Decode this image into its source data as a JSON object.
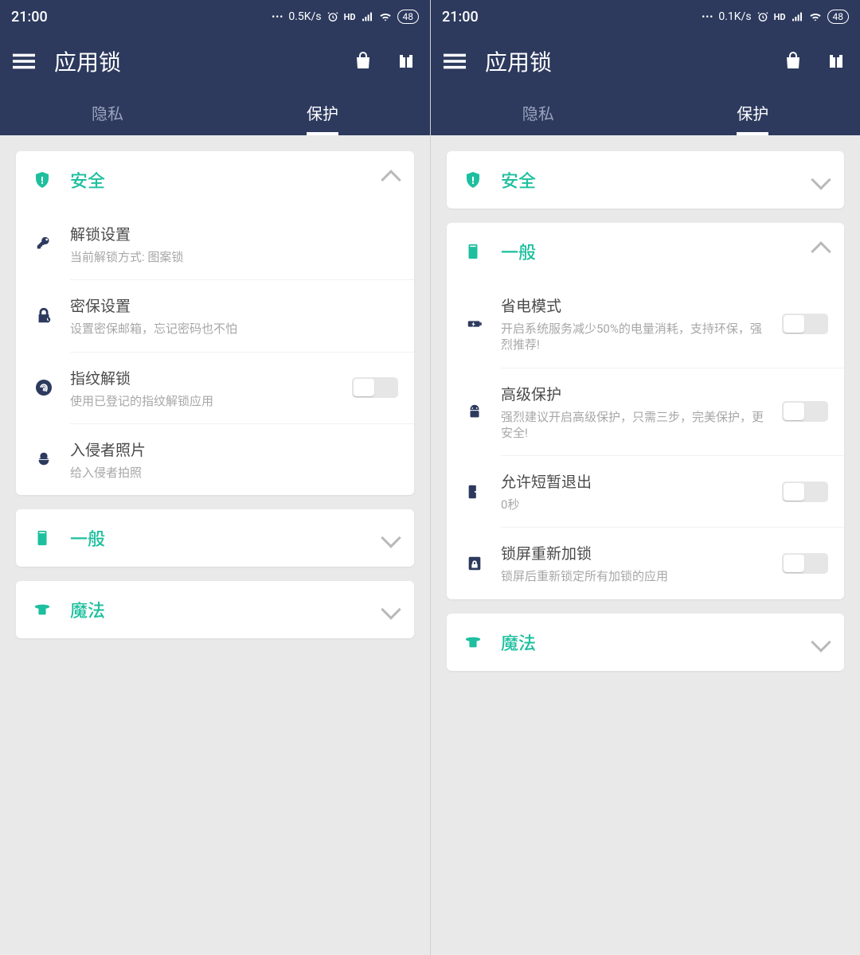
{
  "left": {
    "status": {
      "time": "21:00",
      "speed": "0.5K/s",
      "battery": "48"
    },
    "appTitle": "应用锁",
    "tabs": {
      "privacy": "隐私",
      "protect": "保护"
    },
    "sections": {
      "security": {
        "title": "安全",
        "items": {
          "unlock": {
            "title": "解锁设置",
            "sub": "当前解锁方式: 图案锁"
          },
          "secret": {
            "title": "密保设置",
            "sub": "设置密保邮箱，忘记密码也不怕"
          },
          "finger": {
            "title": "指纹解锁",
            "sub": "使用已登记的指纹解锁应用"
          },
          "intruder": {
            "title": "入侵者照片",
            "sub": "给入侵者拍照"
          }
        }
      },
      "general": {
        "title": "一般"
      },
      "magic": {
        "title": "魔法"
      }
    }
  },
  "right": {
    "status": {
      "time": "21:00",
      "speed": "0.1K/s",
      "battery": "48"
    },
    "appTitle": "应用锁",
    "tabs": {
      "privacy": "隐私",
      "protect": "保护"
    },
    "sections": {
      "security": {
        "title": "安全"
      },
      "general": {
        "title": "一般",
        "items": {
          "power": {
            "title": "省电模式",
            "sub": "开启系统服务减少50%的电量消耗，支持环保，强烈推荐!"
          },
          "adv": {
            "title": "高级保护",
            "sub": "强烈建议开启高级保护，只需三步，完美保护，更安全!"
          },
          "brief": {
            "title": "允许短暂退出",
            "sub": "0秒"
          },
          "relock": {
            "title": "锁屏重新加锁",
            "sub": "锁屏后重新锁定所有加锁的应用"
          }
        }
      },
      "magic": {
        "title": "魔法"
      }
    }
  }
}
